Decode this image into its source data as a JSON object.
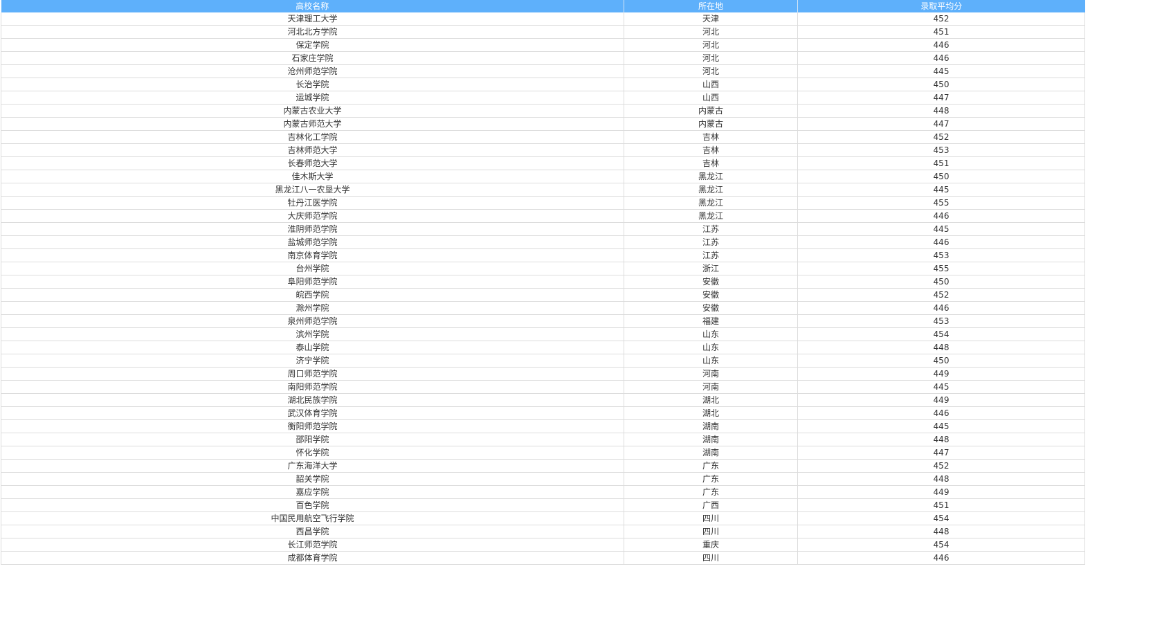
{
  "table": {
    "headers": [
      "高校名称",
      "所在地",
      "录取平均分"
    ],
    "rows": [
      [
        "天津理工大学",
        "天津",
        "452"
      ],
      [
        "河北北方学院",
        "河北",
        "451"
      ],
      [
        "保定学院",
        "河北",
        "446"
      ],
      [
        "石家庄学院",
        "河北",
        "446"
      ],
      [
        "沧州师范学院",
        "河北",
        "445"
      ],
      [
        "长治学院",
        "山西",
        "450"
      ],
      [
        "运城学院",
        "山西",
        "447"
      ],
      [
        "内蒙古农业大学",
        "内蒙古",
        "448"
      ],
      [
        "内蒙古师范大学",
        "内蒙古",
        "447"
      ],
      [
        "吉林化工学院",
        "吉林",
        "452"
      ],
      [
        "吉林师范大学",
        "吉林",
        "453"
      ],
      [
        "长春师范大学",
        "吉林",
        "451"
      ],
      [
        "佳木斯大学",
        "黑龙江",
        "450"
      ],
      [
        "黑龙江八一农垦大学",
        "黑龙江",
        "445"
      ],
      [
        "牡丹江医学院",
        "黑龙江",
        "455"
      ],
      [
        "大庆师范学院",
        "黑龙江",
        "446"
      ],
      [
        "淮阴师范学院",
        "江苏",
        "445"
      ],
      [
        "盐城师范学院",
        "江苏",
        "446"
      ],
      [
        "南京体育学院",
        "江苏",
        "453"
      ],
      [
        "台州学院",
        "浙江",
        "455"
      ],
      [
        "阜阳师范学院",
        "安徽",
        "450"
      ],
      [
        "皖西学院",
        "安徽",
        "452"
      ],
      [
        "滁州学院",
        "安徽",
        "446"
      ],
      [
        "泉州师范学院",
        "福建",
        "453"
      ],
      [
        "滨州学院",
        "山东",
        "454"
      ],
      [
        "泰山学院",
        "山东",
        "448"
      ],
      [
        "济宁学院",
        "山东",
        "450"
      ],
      [
        "周口师范学院",
        "河南",
        "449"
      ],
      [
        "南阳师范学院",
        "河南",
        "445"
      ],
      [
        "湖北民族学院",
        "湖北",
        "449"
      ],
      [
        "武汉体育学院",
        "湖北",
        "446"
      ],
      [
        "衡阳师范学院",
        "湖南",
        "445"
      ],
      [
        "邵阳学院",
        "湖南",
        "448"
      ],
      [
        "怀化学院",
        "湖南",
        "447"
      ],
      [
        "广东海洋大学",
        "广东",
        "452"
      ],
      [
        "韶关学院",
        "广东",
        "448"
      ],
      [
        "嘉应学院",
        "广东",
        "449"
      ],
      [
        "百色学院",
        "广西",
        "451"
      ],
      [
        "中国民用航空飞行学院",
        "四川",
        "454"
      ],
      [
        "西昌学院",
        "四川",
        "448"
      ],
      [
        "长江师范学院",
        "重庆",
        "454"
      ],
      [
        "成都体育学院",
        "四川",
        "446"
      ]
    ]
  }
}
